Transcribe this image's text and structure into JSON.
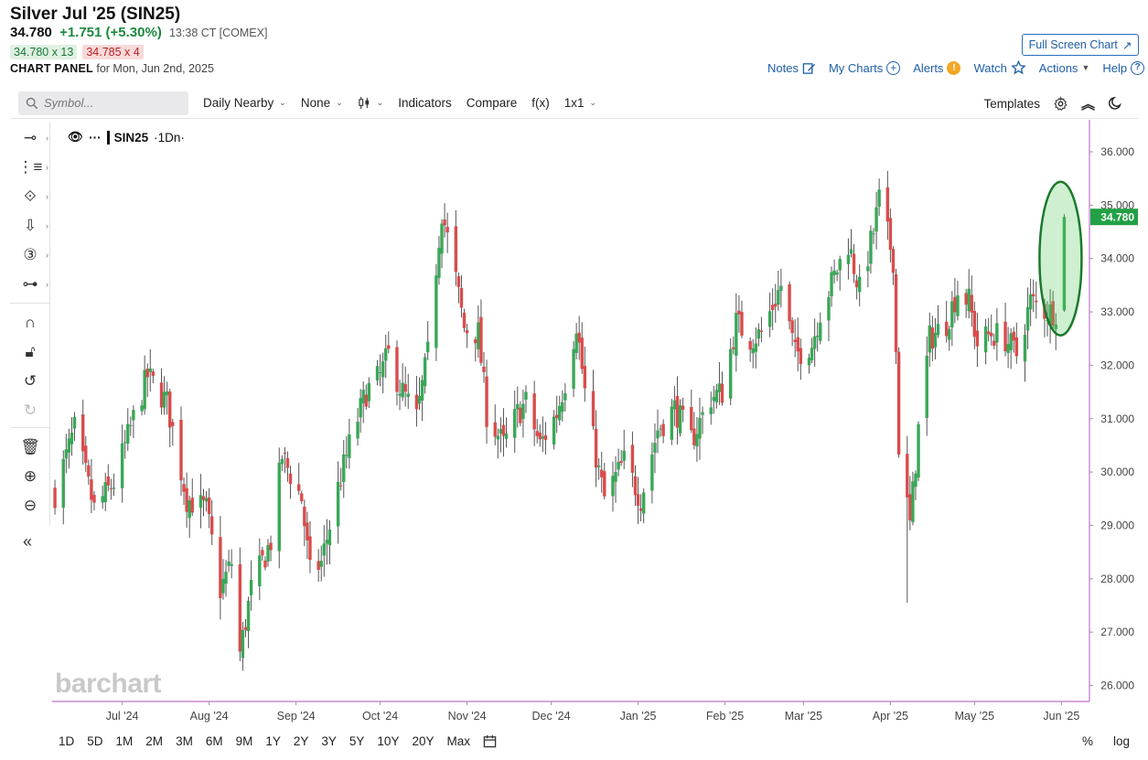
{
  "header": {
    "title": "Silver Jul '25 (SIN25)",
    "last": "34.780",
    "change": "+1.751 (+5.30%)",
    "time": "13:38 CT [COMEX]",
    "bid": "34.780 x 13",
    "ask": "34.785 x 4",
    "panel_label": "CHART PANEL",
    "panel_date": "for Mon, Jun 2nd, 2025",
    "fullscreen_label": "Full Screen Chart",
    "actions": {
      "notes": "Notes",
      "my_charts": "My Charts",
      "alerts": "Alerts",
      "watch": "Watch",
      "actions": "Actions",
      "help": "Help"
    }
  },
  "toolbar": {
    "search_placeholder": "Symbol...",
    "period": "Daily Nearby",
    "study": "None",
    "indicators": "Indicators",
    "compare": "Compare",
    "fx": "f(x)",
    "layout": "1x1",
    "templates": "Templates"
  },
  "legend": {
    "symbol": "SIN25",
    "period": "·1Dn·"
  },
  "watermark": "barchart",
  "bottom": {
    "ranges": [
      "1D",
      "5D",
      "1M",
      "2M",
      "3M",
      "6M",
      "9M",
      "1Y",
      "2Y",
      "3Y",
      "5Y",
      "10Y",
      "20Y",
      "Max"
    ],
    "percent": "%",
    "log": "log"
  },
  "colors": {
    "up": "#3aa757",
    "down": "#d94c4c",
    "axis": "#c071c9",
    "price_tag": "#22a045",
    "highlight": "#1a7a2a"
  },
  "icons": [
    "search-icon",
    "edit-icon",
    "plus-circle-icon",
    "alert-icon",
    "star-icon",
    "help-icon",
    "expand-icon",
    "gear-icon",
    "collapse-icon",
    "moon-icon",
    "eye-icon",
    "calendar-icon"
  ],
  "chart_data": {
    "type": "candlestick",
    "symbol": "SIN25",
    "title": "",
    "xlabel": "",
    "ylabel": "",
    "ylim": [
      25.7,
      36.6
    ],
    "yticks": [
      26,
      27,
      28,
      29,
      30,
      31,
      32,
      33,
      34,
      35,
      36
    ],
    "ytick_labels": [
      "26.000",
      "27.000",
      "28.000",
      "29.000",
      "30.000",
      "31.000",
      "32.000",
      "33.000",
      "34.000",
      "35.000",
      "36.000"
    ],
    "last_price": 34.78,
    "last_price_label": "34.780",
    "xtick_labels": [
      {
        "label": "Jul '24",
        "date": "2024-07-01"
      },
      {
        "label": "Aug '24",
        "date": "2024-08-01"
      },
      {
        "label": "Sep '24",
        "date": "2024-09-01"
      },
      {
        "label": "Oct '24",
        "date": "2024-10-01"
      },
      {
        "label": "Nov '24",
        "date": "2024-11-01"
      },
      {
        "label": "Dec '24",
        "date": "2024-12-01"
      },
      {
        "label": "Jan '25",
        "date": "2025-01-01"
      },
      {
        "label": "Feb '25",
        "date": "2025-02-01"
      },
      {
        "label": "Mar '25",
        "date": "2025-03-01"
      },
      {
        "label": "Apr '25",
        "date": "2025-04-01"
      },
      {
        "label": "May '25",
        "date": "2025-05-01"
      },
      {
        "label": "Jun '25",
        "date": "2025-06-01"
      }
    ],
    "x_range": [
      "2024-06-06",
      "2025-06-11"
    ],
    "first_session": "2024-06-07",
    "last_session": "2025-06-02",
    "close_path": [
      [
        "2024-06-07",
        29.6
      ],
      [
        "2024-06-14",
        30.8
      ],
      [
        "2024-06-21",
        29.3
      ],
      [
        "2024-06-28",
        29.8
      ],
      [
        "2024-07-05",
        31.0
      ],
      [
        "2024-07-10",
        31.8
      ],
      [
        "2024-07-17",
        31.3
      ],
      [
        "2024-07-24",
        29.5
      ],
      [
        "2024-07-31",
        29.3
      ],
      [
        "2024-08-05",
        27.8
      ],
      [
        "2024-08-09",
        28.3
      ],
      [
        "2024-08-12",
        26.6
      ],
      [
        "2024-08-16",
        27.8
      ],
      [
        "2024-08-23",
        28.7
      ],
      [
        "2024-08-27",
        30.3
      ],
      [
        "2024-09-03",
        29.5
      ],
      [
        "2024-09-06",
        28.1
      ],
      [
        "2024-09-10",
        28.3
      ],
      [
        "2024-09-16",
        29.7
      ],
      [
        "2024-09-20",
        30.5
      ],
      [
        "2024-09-26",
        31.5
      ],
      [
        "2024-10-01",
        31.8
      ],
      [
        "2024-10-04",
        32.2
      ],
      [
        "2024-10-08",
        31.6
      ],
      [
        "2024-10-14",
        31.0
      ],
      [
        "2024-10-18",
        32.2
      ],
      [
        "2024-10-22",
        34.4
      ],
      [
        "2024-10-23",
        34.9
      ],
      [
        "2024-10-28",
        33.6
      ],
      [
        "2024-10-31",
        32.7
      ],
      [
        "2024-11-05",
        32.6
      ],
      [
        "2024-11-08",
        31.1
      ],
      [
        "2024-11-14",
        30.5
      ],
      [
        "2024-11-19",
        31.1
      ],
      [
        "2024-11-22",
        31.3
      ],
      [
        "2024-11-27",
        30.5
      ],
      [
        "2024-12-03",
        31.1
      ],
      [
        "2024-12-06",
        31.7
      ],
      [
        "2024-12-10",
        32.8
      ],
      [
        "2024-12-13",
        31.5
      ],
      [
        "2024-12-18",
        30.0
      ],
      [
        "2024-12-20",
        29.5
      ],
      [
        "2024-12-27",
        30.2
      ],
      [
        "2025-01-02",
        29.5
      ],
      [
        "2025-01-08",
        30.8
      ],
      [
        "2025-01-14",
        31.2
      ],
      [
        "2025-01-20",
        30.6
      ],
      [
        "2025-01-27",
        31.4
      ],
      [
        "2025-01-31",
        31.5
      ],
      [
        "2025-02-05",
        32.8
      ],
      [
        "2025-02-10",
        32.5
      ],
      [
        "2025-02-14",
        32.6
      ],
      [
        "2025-02-21",
        33.5
      ],
      [
        "2025-02-26",
        32.2
      ],
      [
        "2025-03-04",
        32.4
      ],
      [
        "2025-03-07",
        33.0
      ],
      [
        "2025-03-13",
        33.8
      ],
      [
        "2025-03-17",
        34.3
      ],
      [
        "2025-03-21",
        33.4
      ],
      [
        "2025-03-26",
        34.5
      ],
      [
        "2025-03-28",
        35.1
      ],
      [
        "2025-04-02",
        34.0
      ],
      [
        "2025-04-04",
        30.5
      ],
      [
        "2025-04-08",
        29.0
      ],
      [
        "2025-04-11",
        30.8
      ],
      [
        "2025-04-15",
        32.5
      ],
      [
        "2025-04-21",
        32.8
      ],
      [
        "2025-04-25",
        33.4
      ],
      [
        "2025-04-29",
        33.2
      ],
      [
        "2025-05-02",
        32.4
      ],
      [
        "2025-05-07",
        32.6
      ],
      [
        "2025-05-12",
        32.5
      ],
      [
        "2025-05-16",
        32.2
      ],
      [
        "2025-05-21",
        33.2
      ],
      [
        "2025-05-27",
        33.0
      ],
      [
        "2025-05-30",
        33.03
      ],
      [
        "2025-06-02",
        34.78
      ]
    ],
    "highlight": {
      "date": "2025-06-02",
      "shape": "ellipse",
      "price_from": 32.8,
      "price_to": 35.2
    },
    "candles_note": "daily OHLC candles; green = up day, red = down day"
  }
}
